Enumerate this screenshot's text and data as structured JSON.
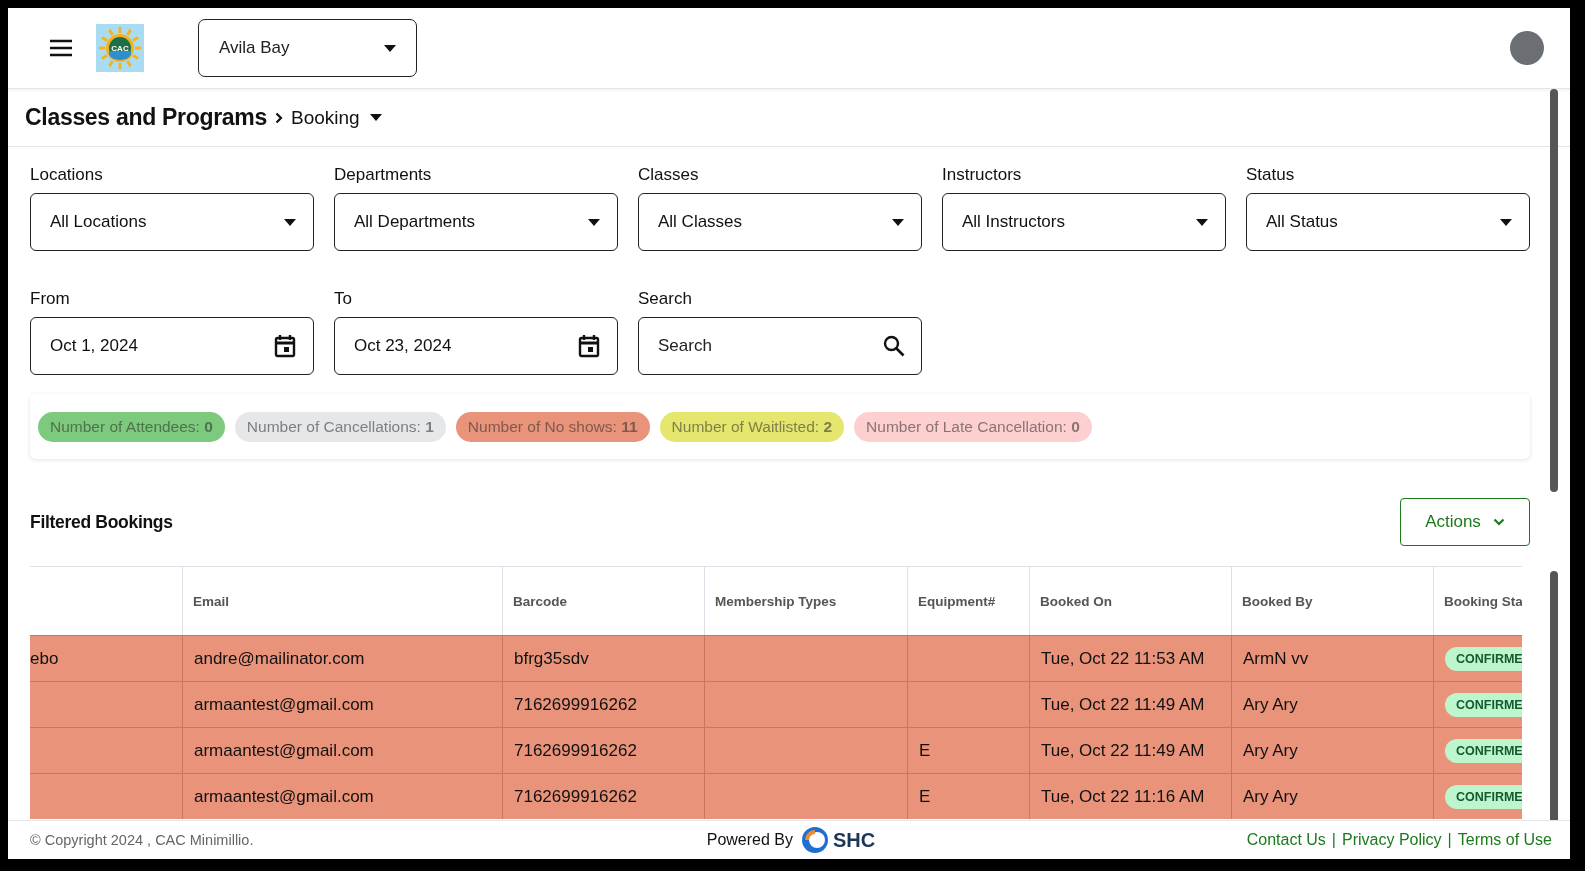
{
  "header": {
    "logo_text": "CAC",
    "location": "Avila Bay"
  },
  "breadcrumb": {
    "section": "Classes and Programs",
    "page": "Booking"
  },
  "filters": [
    {
      "kind": "select",
      "label": "Locations",
      "value": "All Locations"
    },
    {
      "kind": "select",
      "label": "Departments",
      "value": "All Departments"
    },
    {
      "kind": "select",
      "label": "Classes",
      "value": "All Classes"
    },
    {
      "kind": "select",
      "label": "Instructors",
      "value": "All Instructors"
    },
    {
      "kind": "select",
      "label": "Status",
      "value": "All Status"
    },
    {
      "kind": "date",
      "label": "From",
      "value": "Oct 1, 2024"
    },
    {
      "kind": "date",
      "label": "To",
      "value": "Oct 23, 2024"
    },
    {
      "kind": "search",
      "label": "Search",
      "placeholder": "Search"
    }
  ],
  "stats": [
    {
      "text": "Number of Attendees: **0**",
      "color": "#7dc97d"
    },
    {
      "text": "Number of Cancellations: **1**",
      "color": "#e6e7e9"
    },
    {
      "text": "Number of No shows: **11**",
      "color": "#e8937a"
    },
    {
      "text": "Number of Waitlisted: **2**",
      "color": "#e5e66e"
    },
    {
      "text": "Number of Late Cancellation: **0**",
      "color": "#fdcfcf"
    }
  ],
  "bookings": {
    "title": "Filtered Bookings",
    "actions_label": "Actions",
    "columns": [
      "Email",
      "Barcode",
      "Membership Types",
      "Equipment#",
      "Booked On",
      "Booked By",
      "Booking Sta"
    ],
    "rows": [
      {
        "column_1": "ebo",
        "cells": [
          "andre@mailinator.com",
          "bfrg35sdv",
          "",
          "",
          "Tue, Oct 22 11:53 AM",
          "ArmN vv"
        ],
        "status": "CONFIRME"
      },
      {
        "cells": [
          "armaantest@gmail.com",
          "7162699916262",
          "",
          "",
          "Tue, Oct 22 11:49 AM",
          "Ary Ary"
        ],
        "status": "CONFIRME"
      },
      {
        "cells": [
          "armaantest@gmail.com",
          "7162699916262",
          "",
          "E",
          "Tue, Oct 22 11:49 AM",
          "Ary Ary"
        ],
        "status": "CONFIRME"
      },
      {
        "cells": [
          "armaantest@gmail.com",
          "7162699916262",
          "",
          "E",
          "Tue, Oct 22 11:16 AM",
          "Ary Ary"
        ],
        "status": "CONFIRME"
      }
    ]
  },
  "footer": {
    "copyright": "© Copyright 2024 , CAC Minimillio.",
    "powered_by": "Powered By",
    "brand": "SHC",
    "links": [
      {
        "label": "Contact Us",
        "separator": "|"
      },
      {
        "label": "Privacy Policy",
        "separator": "|"
      },
      {
        "label": "Terms of Use"
      }
    ]
  }
}
